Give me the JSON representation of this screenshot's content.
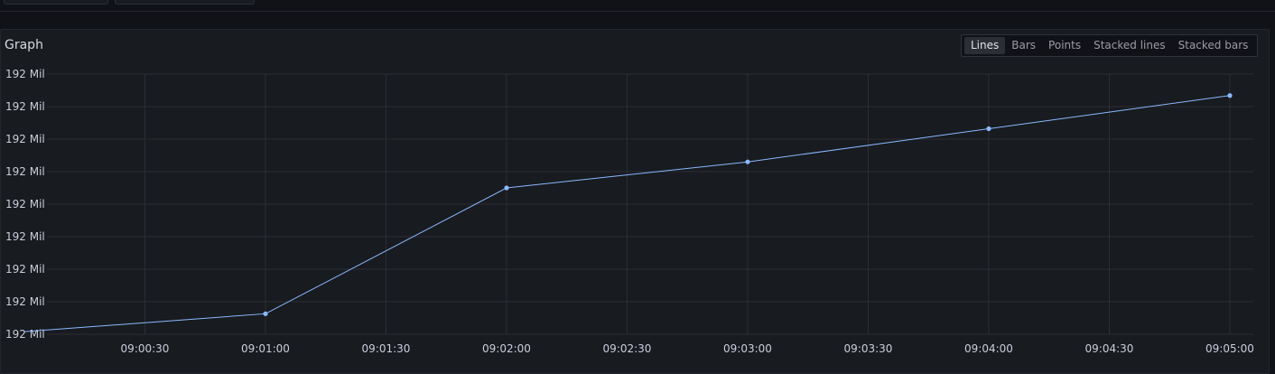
{
  "panel": {
    "title": "Graph",
    "display_modes": [
      "Lines",
      "Bars",
      "Points",
      "Stacked lines",
      "Stacked bars"
    ],
    "active_mode": "Lines"
  },
  "colors": {
    "series": "#8ab8ff",
    "grid": "#2b2e36",
    "background": "#181b1f"
  },
  "chart_data": {
    "type": "line",
    "title": "",
    "xlabel": "",
    "ylabel": "",
    "grid": true,
    "x_range": [
      "09:00:00",
      "09:05:00"
    ],
    "y_range": [
      0,
      8
    ],
    "y_tick_labels": [
      "192 Mil",
      "192 Mil",
      "192 Mil",
      "192 Mil",
      "192 Mil",
      "192 Mil",
      "192 Mil",
      "192 Mil",
      "192 Mil"
    ],
    "x_tick_labels": [
      "09:00:30",
      "09:01:00",
      "09:01:30",
      "09:02:00",
      "09:02:30",
      "09:03:00",
      "09:03:30",
      "09:04:00",
      "09:04:30",
      "09:05:00"
    ],
    "series": [
      {
        "x": [
          "09:00:00",
          "09:01:00",
          "09:02:00",
          "09:03:00",
          "09:04:00",
          "09:05:00"
        ],
        "values": [
          0.08,
          0.63,
          4.5,
          5.3,
          6.32,
          7.34
        ],
        "markers": [
          false,
          true,
          true,
          true,
          true,
          true
        ]
      }
    ]
  }
}
